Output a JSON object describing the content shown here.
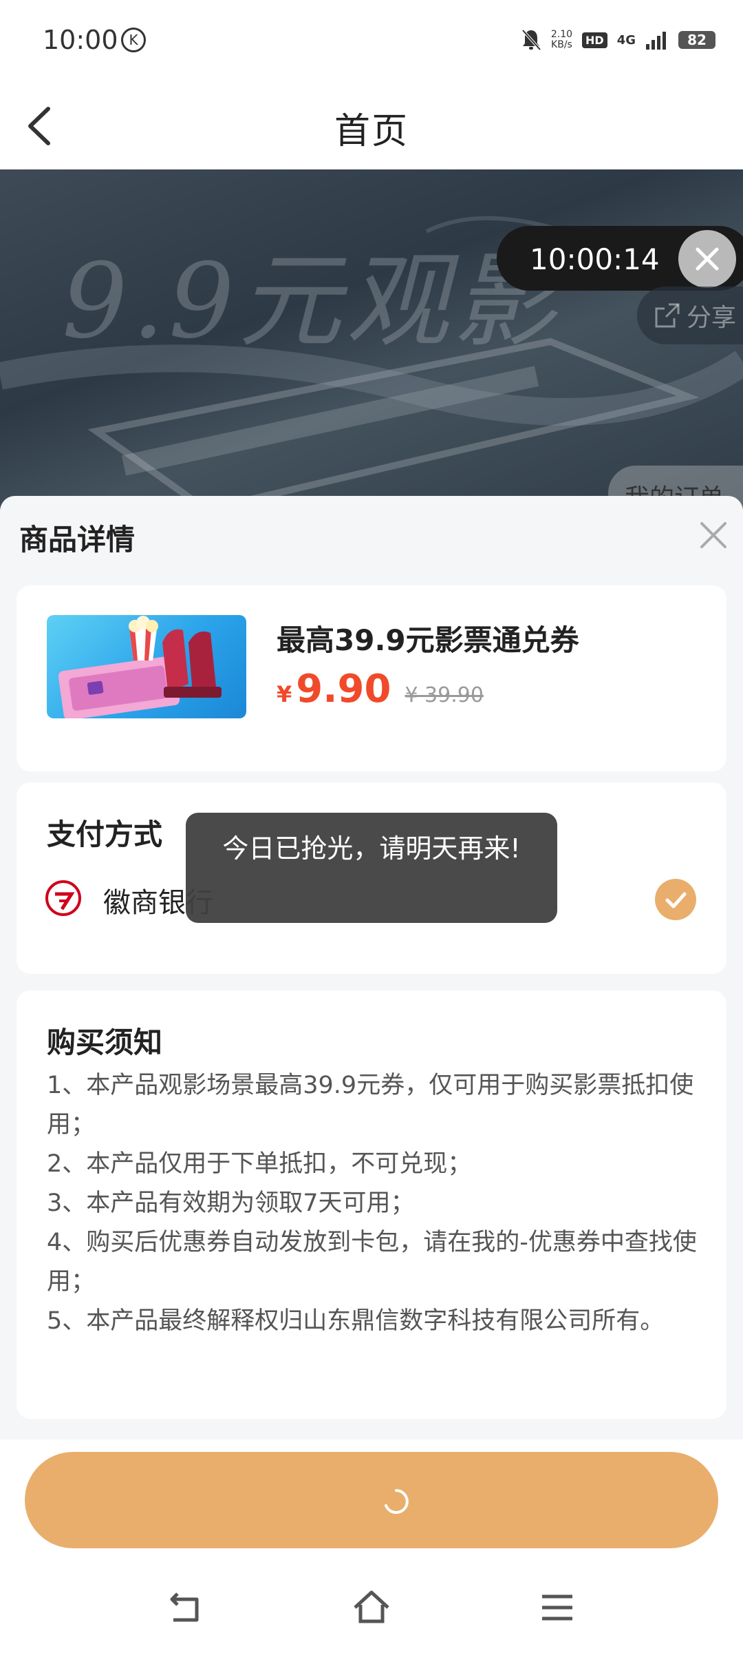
{
  "status_bar": {
    "time": "10:00",
    "k_badge": "K",
    "speed_value": "2.10",
    "speed_unit": "KB/s",
    "hd": "HD",
    "network": "4G",
    "battery": "82"
  },
  "nav": {
    "title": "首页"
  },
  "banner": {
    "headline": "9.9元观影",
    "timer": "10:00:14",
    "share_label": "分享",
    "orders_label": "我的订单"
  },
  "sheet": {
    "title": "商品详情",
    "product": {
      "name": "最高39.9元影票通兑券",
      "price_symbol": "¥",
      "price": "9.90",
      "original_price": "¥ 39.90"
    },
    "payment": {
      "title": "支付方式",
      "bank_name": "徽商银行",
      "selected": true
    },
    "notice": {
      "title": "购买须知",
      "items": [
        "1、本产品观影场景最高39.9元券，仅可用于购买影票抵扣使用；",
        "2、本产品仅用于下单抵扣，不可兑现；",
        "3、本产品有效期为领取7天可用；",
        "4、购买后优惠券自动发放到卡包，请在我的-优惠券中查找使用；",
        "5、本产品最终解释权归山东鼎信数字科技有限公司所有。"
      ]
    }
  },
  "toast": {
    "message": "今日已抢光，请明天再来!"
  },
  "colors": {
    "accent": "#e9ae6c",
    "price_red": "#f04a2a",
    "toast_bg": "#404040"
  },
  "icons": {
    "back": "chevron-left-icon",
    "close": "close-icon",
    "share": "share-icon",
    "check": "check-icon",
    "spinner": "loading-spinner-icon",
    "nav_back": "system-back-icon",
    "nav_home": "system-home-icon",
    "nav_menu": "system-menu-icon"
  }
}
